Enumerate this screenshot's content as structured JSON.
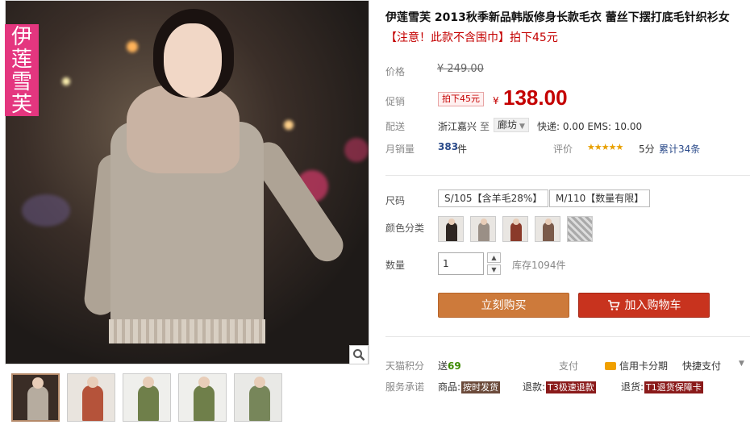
{
  "product": {
    "title": "伊莲雪芙 2013秋季新品韩版修身长款毛衣 蕾丝下摆打底毛针织衫女",
    "notice_mark": "【注意！此款不含围巾】",
    "notice_after": "拍下45元",
    "brand_tag": "伊莲雪芙"
  },
  "price": {
    "label": "价格",
    "original": "¥ 249.00",
    "promo_label": "促销",
    "promo_tag": "拍下45元",
    "yen": "¥",
    "promo_price": "138.00"
  },
  "shipping": {
    "label": "配送",
    "origin": "浙江嘉兴",
    "to": "至",
    "destination": "廊坊",
    "fees": "快递: 0.00 EMS: 10.00"
  },
  "sales": {
    "label": "月销量",
    "count": "383",
    "unit": "件",
    "rating_label": "评价",
    "stars": "★★★★★",
    "score": "5分",
    "reviews": "累计34条"
  },
  "size": {
    "label": "尺码",
    "options": [
      "S/105【含羊毛28%】",
      "M/110【数量有限】"
    ]
  },
  "color": {
    "label": "颜色分类",
    "swatches": [
      "#2e2622",
      "#9a8f86",
      "#8a3a2a",
      "#7a5a4a",
      "#b8b8b8"
    ]
  },
  "quantity": {
    "label": "数量",
    "value": "1",
    "stock": "库存1094件"
  },
  "buttons": {
    "buy": "立刻购买",
    "cart": "加入购物车"
  },
  "points": {
    "label": "天猫积分",
    "give": "送",
    "amount": "69",
    "pay_label": "支付",
    "credit": "信用卡分期",
    "quickpay": "快捷支付"
  },
  "promise": {
    "label": "服务承诺",
    "goods_prefix": "商品:",
    "goods_badge": "按时发货",
    "refund_prefix": "退款:",
    "refund_badge": "T3极速退款",
    "return_prefix": "退货:",
    "return_badge": "T1退货保障卡"
  },
  "thumbs": [
    {
      "bg": "#3a2d26",
      "fig": "#b6ac9f"
    },
    {
      "bg": "#e9e4de",
      "fig": "#b5533a"
    },
    {
      "bg": "#efefec",
      "fig": "#6f7f4a"
    },
    {
      "bg": "#efefec",
      "fig": "#6f7f4a"
    },
    {
      "bg": "#e9e9e6",
      "fig": "#77865a"
    }
  ]
}
